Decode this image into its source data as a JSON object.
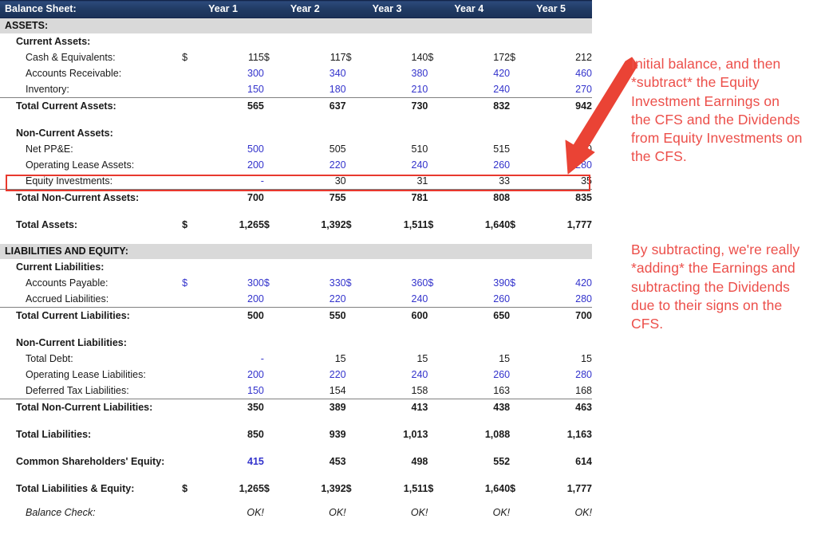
{
  "header": {
    "title": "Balance Sheet:",
    "years": [
      "Year 1",
      "Year 2",
      "Year 3",
      "Year 4",
      "Year 5"
    ]
  },
  "colors": {
    "header_band": "#1f3864",
    "section_band": "#d9d9d9",
    "hardcode_blue": "#3333cc",
    "annotation_red": "#ec4f4a",
    "highlight_red": "#e8392e"
  },
  "sections": {
    "assets_header": "ASSETS:",
    "liabilities_header": "LIABILITIES AND EQUITY:"
  },
  "rows": {
    "current_assets_header": "Current Assets:",
    "cash": {
      "label": "Cash & Equivalents:",
      "currency": "$",
      "values": [
        "115",
        "117",
        "140",
        "172",
        "212"
      ]
    },
    "accounts_receivable": {
      "label": "Accounts Receivable:",
      "values": [
        "300",
        "340",
        "380",
        "420",
        "460"
      ]
    },
    "inventory": {
      "label": "Inventory:",
      "values": [
        "150",
        "180",
        "210",
        "240",
        "270"
      ]
    },
    "total_current_assets": {
      "label": "Total Current Assets:",
      "values": [
        "565",
        "637",
        "730",
        "832",
        "942"
      ]
    },
    "non_current_assets_header": "Non-Current Assets:",
    "net_ppe": {
      "label": "Net PP&E:",
      "values": [
        "500",
        "505",
        "510",
        "515",
        "520"
      ]
    },
    "operating_lease_assets": {
      "label": "Operating Lease Assets:",
      "values": [
        "200",
        "220",
        "240",
        "260",
        "280"
      ]
    },
    "equity_investments": {
      "label": "Equity Investments:",
      "values": [
        "-",
        "30",
        "31",
        "33",
        "35"
      ]
    },
    "total_non_current_assets": {
      "label": "Total Non-Current Assets:",
      "values": [
        "700",
        "755",
        "781",
        "808",
        "835"
      ]
    },
    "total_assets": {
      "label": "Total Assets:",
      "currency": "$",
      "values": [
        "1,265",
        "1,392",
        "1,511",
        "1,640",
        "1,777"
      ]
    },
    "current_liabilities_header": "Current Liabilities:",
    "accounts_payable": {
      "label": "Accounts Payable:",
      "currency": "$",
      "values": [
        "300",
        "330",
        "360",
        "390",
        "420"
      ]
    },
    "accrued_liabilities": {
      "label": "Accrued Liabilities:",
      "values": [
        "200",
        "220",
        "240",
        "260",
        "280"
      ]
    },
    "total_current_liabilities": {
      "label": "Total Current Liabilities:",
      "values": [
        "500",
        "550",
        "600",
        "650",
        "700"
      ]
    },
    "non_current_liabilities_header": "Non-Current Liabilities:",
    "total_debt": {
      "label": "Total Debt:",
      "values": [
        "-",
        "15",
        "15",
        "15",
        "15"
      ]
    },
    "operating_lease_liabilities": {
      "label": "Operating Lease Liabilities:",
      "values": [
        "200",
        "220",
        "240",
        "260",
        "280"
      ]
    },
    "deferred_tax_liabilities": {
      "label": "Deferred Tax Liabilities:",
      "values": [
        "150",
        "154",
        "158",
        "163",
        "168"
      ]
    },
    "total_non_current_liabilities": {
      "label": "Total Non-Current Liabilities:",
      "values": [
        "350",
        "389",
        "413",
        "438",
        "463"
      ]
    },
    "total_liabilities": {
      "label": "Total Liabilities:",
      "values": [
        "850",
        "939",
        "1,013",
        "1,088",
        "1,163"
      ]
    },
    "common_shareholders_equity": {
      "label": "Common Shareholders' Equity:",
      "values": [
        "415",
        "453",
        "498",
        "552",
        "614"
      ]
    },
    "total_liabilities_equity": {
      "label": "Total Liabilities & Equity:",
      "currency": "$",
      "values": [
        "1,265",
        "1,392",
        "1,511",
        "1,640",
        "1,777"
      ]
    },
    "balance_check": {
      "label": "Balance Check:",
      "values": [
        "OK!",
        "OK!",
        "OK!",
        "OK!",
        "OK!"
      ]
    }
  },
  "annotations": {
    "note_1": "Initial balance, and then *subtract* the Equity Investment Earnings on the CFS and the Dividends from Equity Investments on the CFS.",
    "note_2": "By subtracting, we're really *adding* the Earnings and subtracting the Dividends due to their signs on the CFS.",
    "arrow": "red-down-left-arrow",
    "highlight_target": "Equity Investments:"
  }
}
